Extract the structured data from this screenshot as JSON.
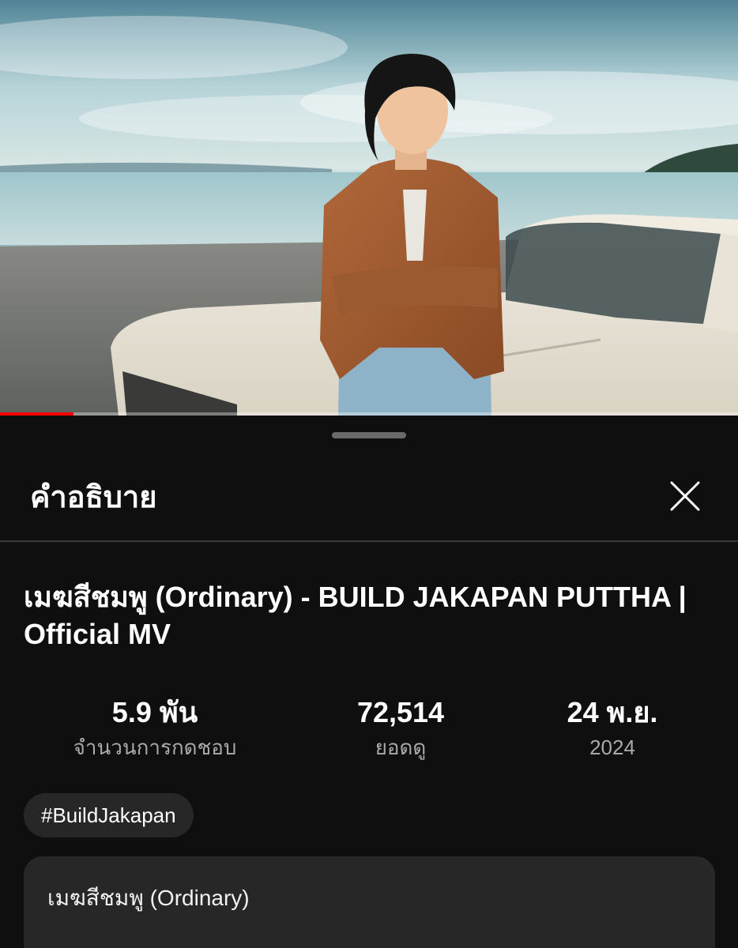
{
  "video": {
    "progress": 0.1,
    "accent_color": "#ff0000"
  },
  "sheet": {
    "title": "คำอธิบาย",
    "close_icon": "close-icon"
  },
  "details": {
    "title": "เมฆสีชมพู (Ordinary) - BUILD JAKAPAN PUTTHA | Official MV",
    "stats": {
      "likes_value": "5.9 พัน",
      "likes_label": "จำนวนการกดชอบ",
      "views_value": "72,514",
      "views_label": "ยอดดู",
      "date_value": "24 พ.ย.",
      "date_year": "2024"
    },
    "hashtag": "#BuildJakapan",
    "description_first_line": "เมฆสีชมพู (Ordinary)"
  }
}
